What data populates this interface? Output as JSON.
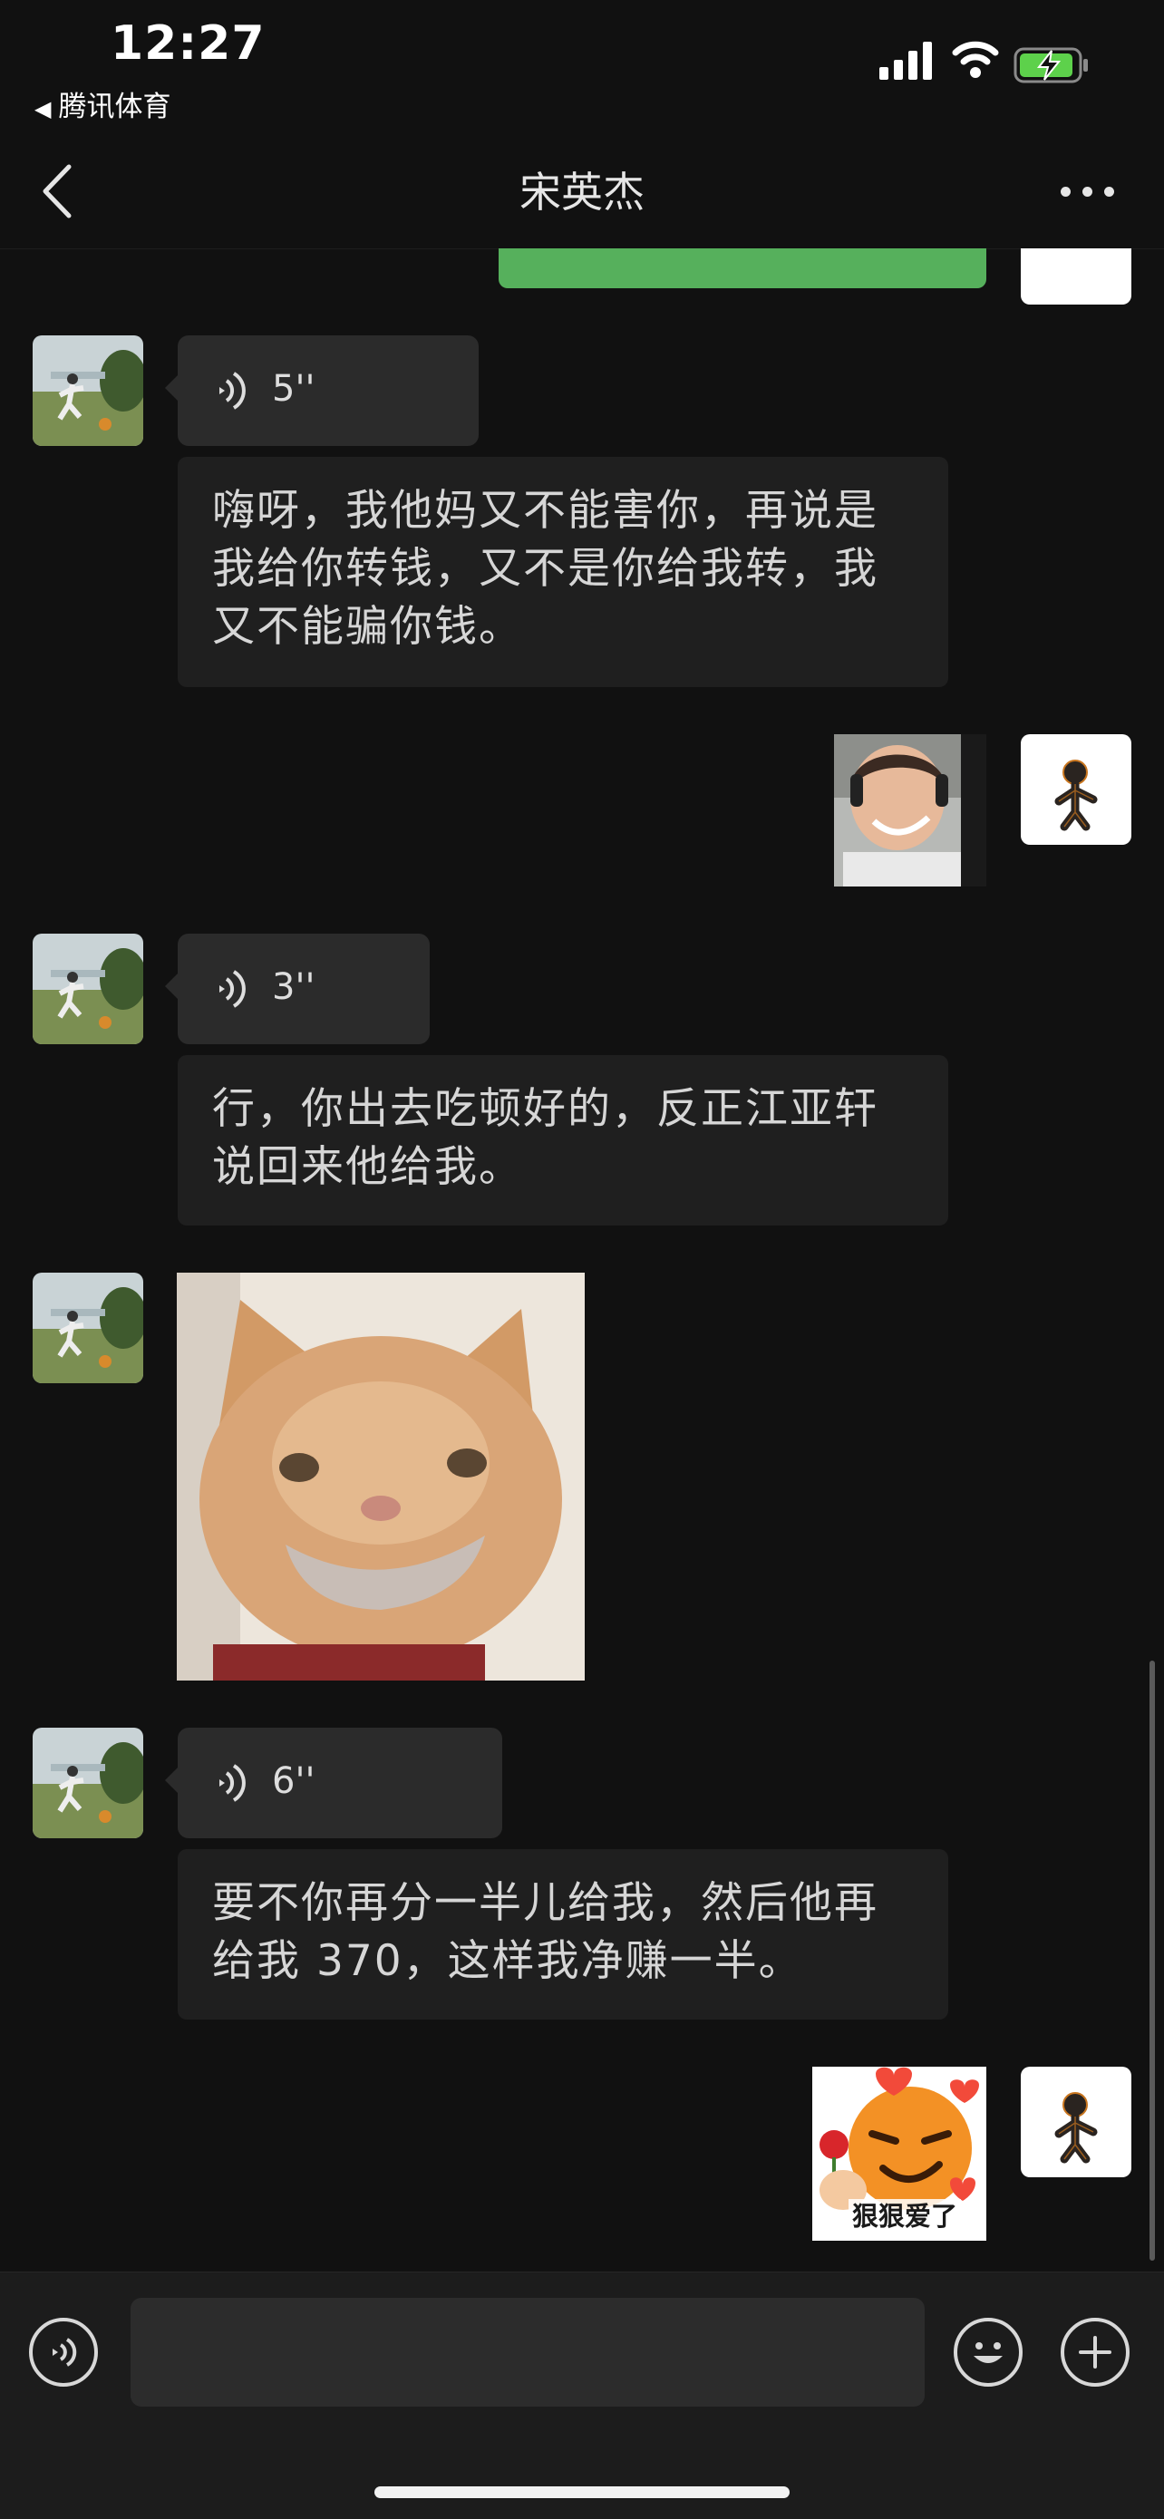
{
  "status_bar": {
    "time": "12:27",
    "back_app_label": "腾讯体育",
    "back_arrow": "◀"
  },
  "nav": {
    "title": "宋英杰",
    "back_icon": "chevron-left-icon",
    "more_icon": "ellipsis-icon"
  },
  "messages": [
    {
      "sender": "contact",
      "type": "voice",
      "duration": "5''"
    },
    {
      "sender": "contact",
      "type": "text",
      "text": "嗨呀，我他妈又不能害你，再说是我给你转钱，又不是你给我转，我又不能骗你钱。"
    },
    {
      "sender": "self",
      "type": "image",
      "description": "sticker"
    },
    {
      "sender": "contact",
      "type": "voice",
      "duration": "3''"
    },
    {
      "sender": "contact",
      "type": "text",
      "text": "行，你出去吃顿好的，反正江亚轩说回来他给我。"
    },
    {
      "sender": "contact",
      "type": "image",
      "description": "sticker"
    },
    {
      "sender": "contact",
      "type": "voice",
      "duration": "6''"
    },
    {
      "sender": "contact",
      "type": "text",
      "text": "要不你再分一半儿给我，然后他再给我 370，这样我净赚一半。"
    },
    {
      "sender": "self",
      "type": "sticker",
      "caption": "狠狠爱了"
    }
  ],
  "input_bar": {
    "voice_icon": "voice-mode-icon",
    "emoji_icon": "emoji-icon",
    "plus_icon": "plus-icon",
    "input_value": ""
  },
  "colors": {
    "background": "#111111",
    "bubble_contact": "#1f1f1f",
    "bubble_voice": "#2b2b2b",
    "bubble_self": "#56b05c",
    "input_bar": "#1c1c1c"
  }
}
